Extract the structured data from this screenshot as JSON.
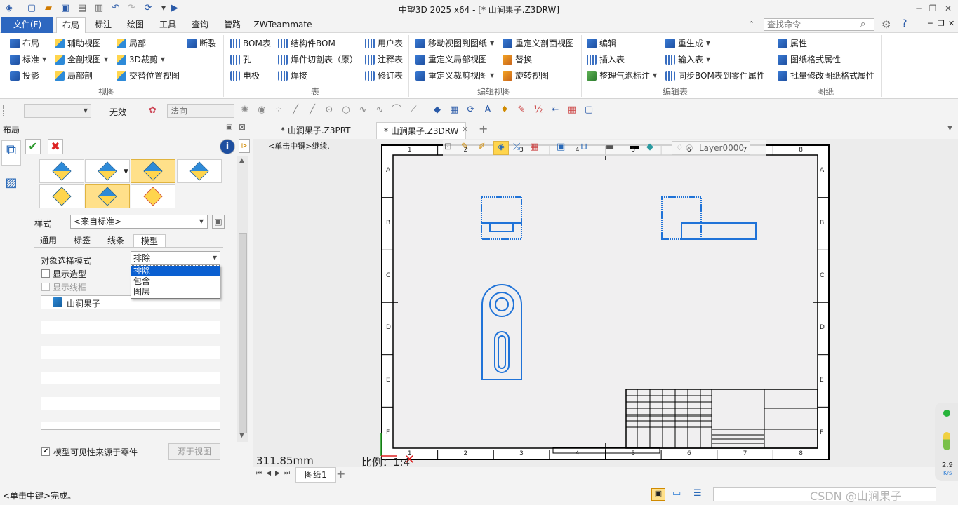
{
  "window": {
    "title": "中望3D 2025 x64 - [* 山涧果子.Z3DRW]"
  },
  "menu": {
    "file": "文件(F)",
    "tabs": [
      "布局",
      "标注",
      "绘图",
      "工具",
      "查询",
      "管路",
      "ZWTeammate"
    ],
    "search_placeholder": "查找命令"
  },
  "ribbon": {
    "view": {
      "items": [
        "布局",
        "辅助视图",
        "局部",
        "断裂",
        "标准",
        "全剖视图",
        "3D裁剪",
        "投影",
        "局部剖",
        "交替位置视图"
      ],
      "label": "视图"
    },
    "table": {
      "items": [
        "BOM表",
        "结构件BOM",
        "用户表",
        "孔",
        "焊件切割表（原）",
        "注释表",
        "电极",
        "焊接",
        "修订表"
      ],
      "label": "表"
    },
    "edit_view": {
      "items": [
        "移动视图到图纸",
        "重定义剖面视图",
        "重定义局部视图",
        "替换",
        "重定义裁剪视图",
        "旋转视图"
      ],
      "label": "编辑视图"
    },
    "edit_table": {
      "items": [
        "编辑",
        "重生成",
        "插入表",
        "输入表",
        "整理气泡标注",
        "同步BOM表到零件属性"
      ],
      "label": "编辑表"
    },
    "sheet": {
      "items": [
        "属性",
        "图纸格式属性",
        "批量修改图纸格式属性"
      ],
      "label": "图纸"
    }
  },
  "toolbar2": {
    "filter_value": "无效",
    "direction_placeholder": "法向"
  },
  "panel": {
    "title": "布局",
    "style_label": "样式",
    "style_value": "<来自标准>",
    "tabs": [
      "通用",
      "标签",
      "线条",
      "模型"
    ],
    "selection_mode_label": "对象选择模式",
    "selection_mode_value": "排除",
    "dropdown_options": [
      "排除",
      "包含",
      "图层"
    ],
    "show_model": "显示造型",
    "show_wireframe": "显示线框",
    "tree_root": "山涧果子",
    "visibility_from_part": "模型可见性来源于零件",
    "from_view_button": "源于视图"
  },
  "documents": {
    "tabs": [
      "* 山涧果子.Z3PRT",
      "* 山涧果子.Z3DRW"
    ]
  },
  "canvas": {
    "prompt": "<单击中键>继续.",
    "layer": "Layer0000",
    "measure": "311.85mm",
    "scale": "比例：1:4",
    "col_labels": [
      "1",
      "2",
      "3",
      "4",
      "5",
      "6",
      "7",
      "8"
    ],
    "row_labels": [
      "A",
      "B",
      "C",
      "D",
      "E",
      "F"
    ]
  },
  "sheets": {
    "tab": "图纸1"
  },
  "status": {
    "message": "<单击中键>完成。",
    "watermark": "CSDN @山涧果子"
  },
  "perf": {
    "value": "2.9",
    "unit": "K/s"
  }
}
